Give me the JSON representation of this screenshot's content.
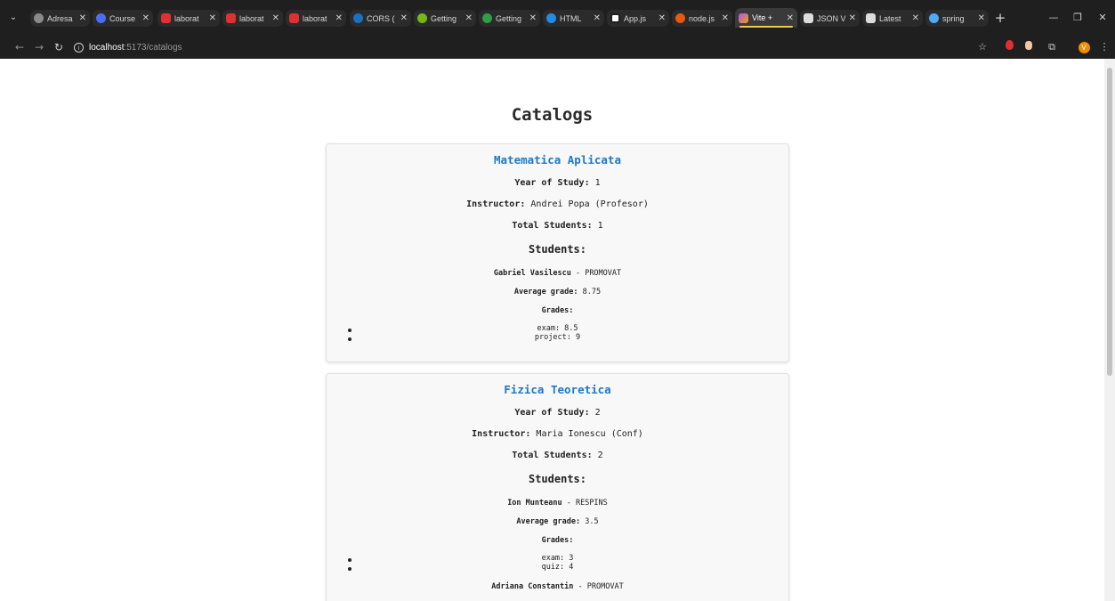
{
  "browser": {
    "tabs": [
      {
        "label": "Adresa",
        "fav": "#8a8a8a"
      },
      {
        "label": "Course",
        "fav": "#4c6ef5"
      },
      {
        "label": "laborat",
        "fav": "#e03131"
      },
      {
        "label": "laborat",
        "fav": "#e03131"
      },
      {
        "label": "laborat",
        "fav": "#e03131"
      },
      {
        "label": "CORS (",
        "fav": "#1971c2"
      },
      {
        "label": "Getting",
        "fav": "#74b816"
      },
      {
        "label": "Getting",
        "fav": "#2f9e44"
      },
      {
        "label": "HTML",
        "fav": "#228be6"
      },
      {
        "label": "App.js",
        "fav": "#ffffff"
      },
      {
        "label": "node.js",
        "fav": "#e8590c"
      },
      {
        "label": "Vite + ",
        "fav": "#a855f7"
      },
      {
        "label": "JSON V",
        "fav": "#dddddd"
      },
      {
        "label": "Latest",
        "fav": "#dddddd"
      },
      {
        "label": "spring",
        "fav": "#4dabf7"
      }
    ],
    "url_host": "localhost",
    "url_path": ":5173/catalogs",
    "close_glyph": "✕"
  },
  "page": {
    "title": "Catalogs",
    "labels": {
      "year": "Year of Study:",
      "instructor": "Instructor:",
      "total": "Total Students:",
      "students": "Students:",
      "average": "Average grade:",
      "grades": "Grades:"
    },
    "catalogs": [
      {
        "name": "Matematica Aplicata",
        "year": "1",
        "instructor": "Andrei Popa (Profesor)",
        "total": "1",
        "students": [
          {
            "name": "Gabriel Vasilescu",
            "status": " - PROMOVAT",
            "average": "8.75",
            "grades": [
              "exam: 8.5",
              "project: 9"
            ]
          }
        ]
      },
      {
        "name": "Fizica Teoretica",
        "year": "2",
        "instructor": "Maria Ionescu (Conf)",
        "total": "2",
        "students": [
          {
            "name": "Ion Munteanu",
            "status": " - RESPINS",
            "average": "3.5",
            "grades": [
              "exam: 3",
              "quiz: 4"
            ]
          },
          {
            "name": "Adriana Constantin",
            "status": " - PROMOVAT"
          }
        ]
      }
    ]
  }
}
